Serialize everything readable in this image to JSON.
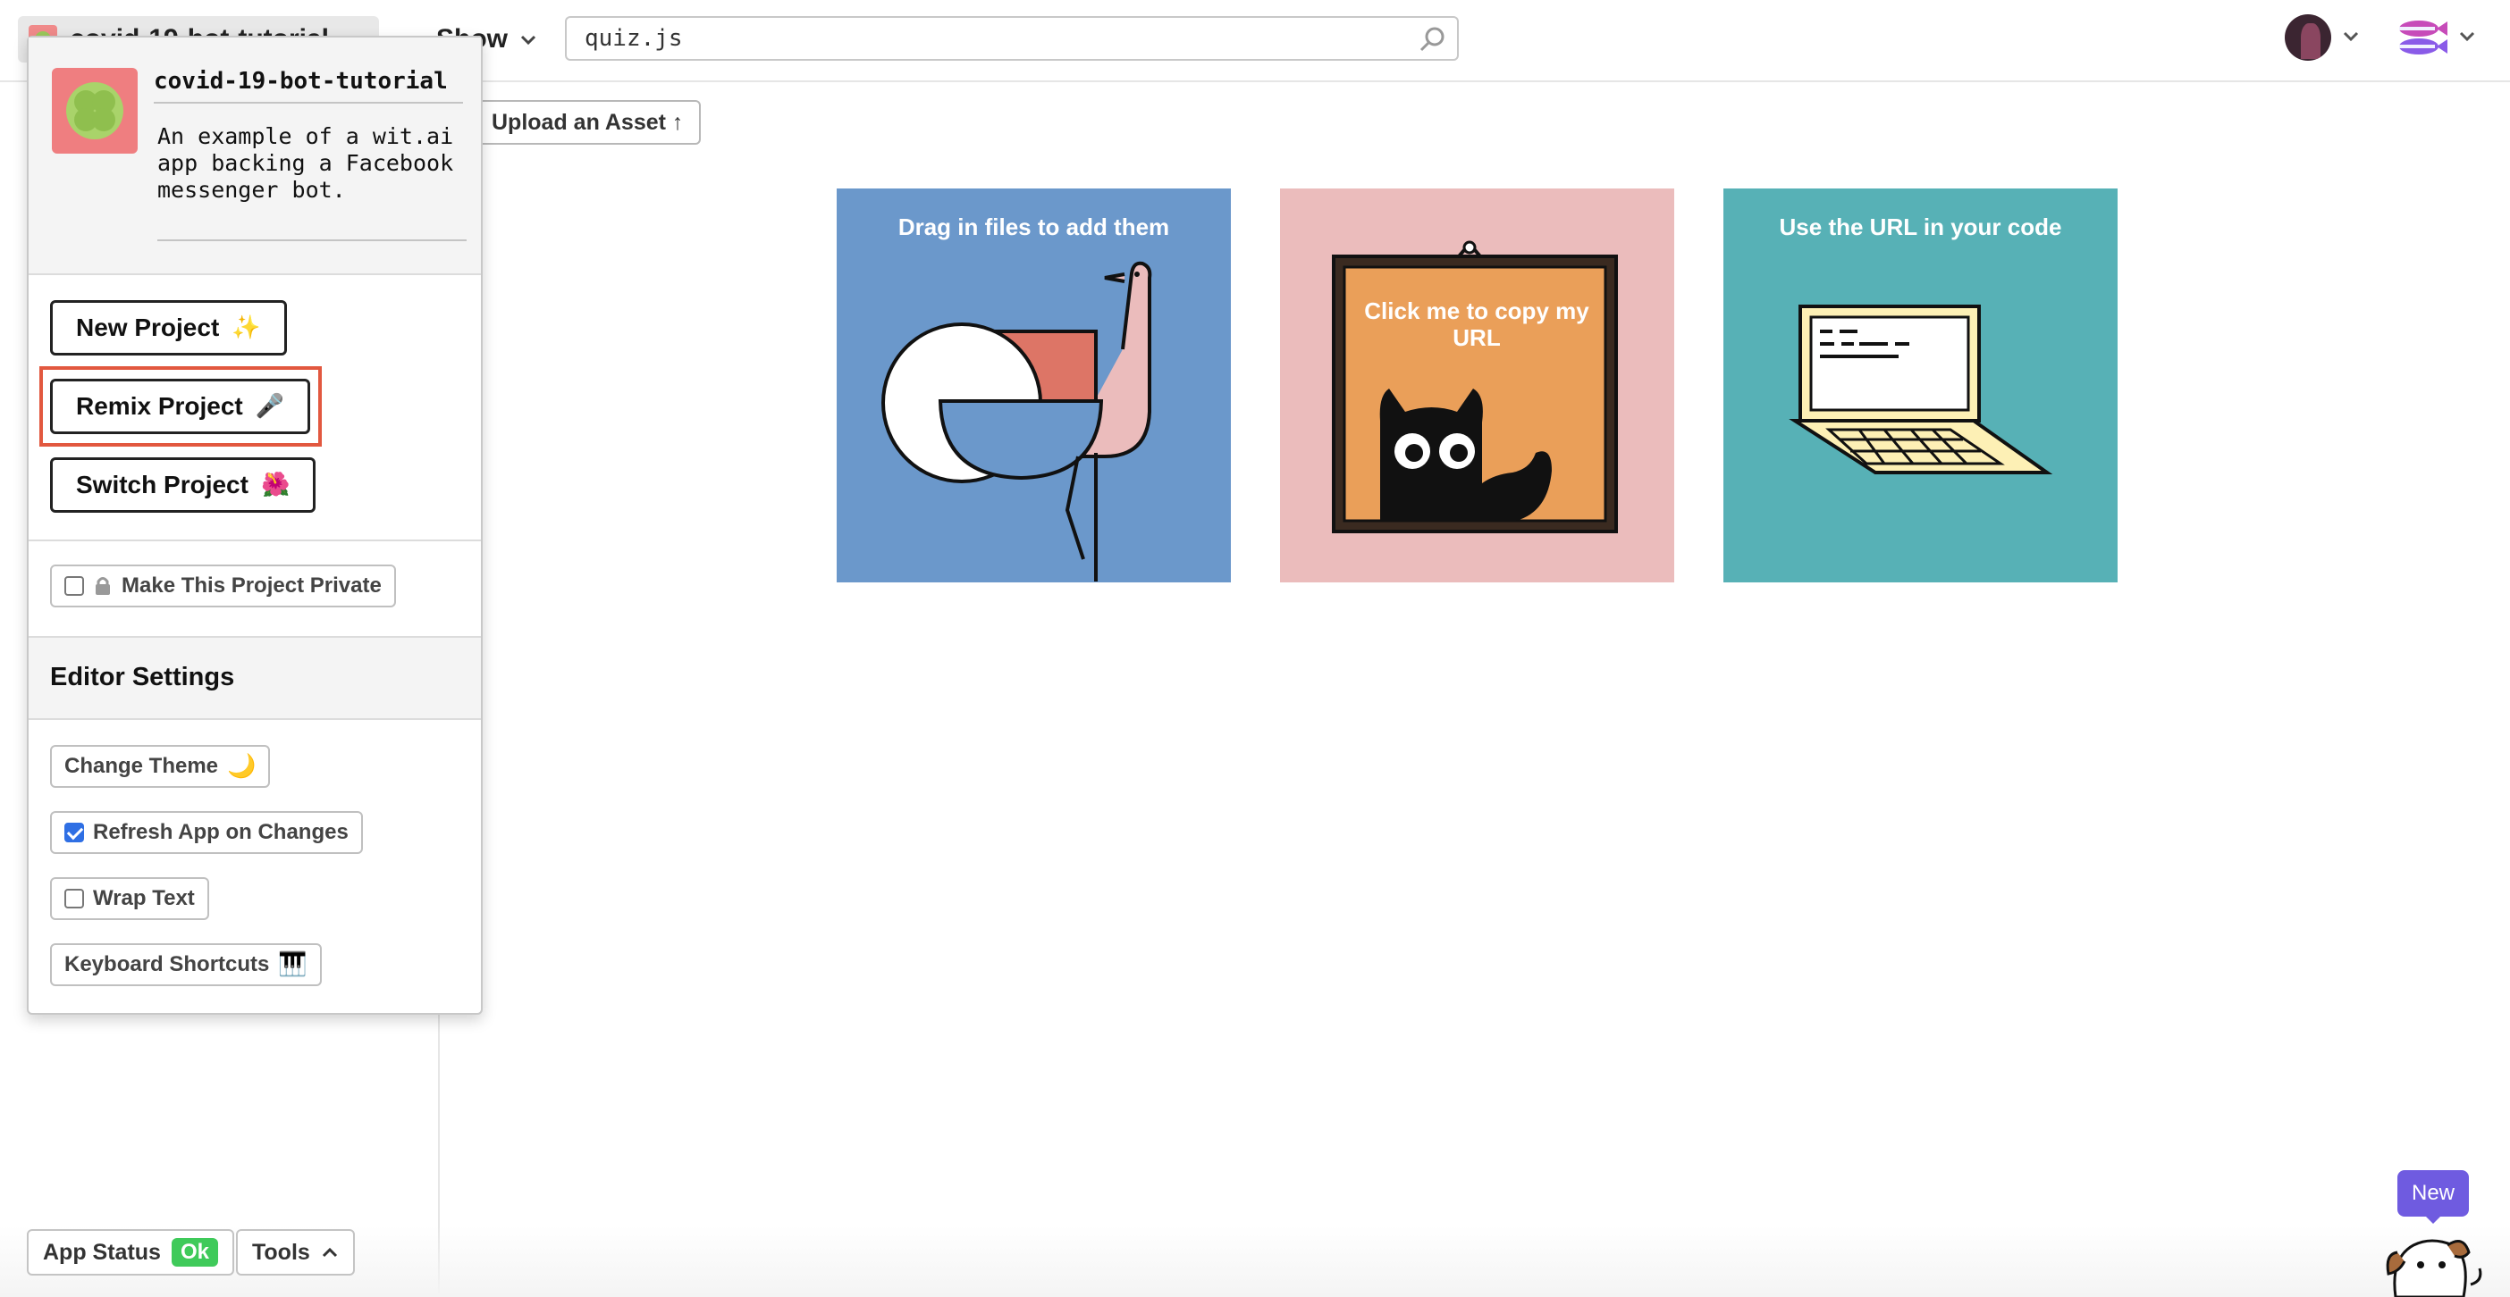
{
  "header": {
    "project_pill": "covid-19-bot-tutorial",
    "show_label": "Show",
    "search_value": "quiz.js"
  },
  "toolbar": {
    "upload_label": "Upload an Asset ↑"
  },
  "cards": [
    {
      "title": "Drag in files to add them",
      "color": "#6b98cb"
    },
    {
      "title": "Click me to copy my URL",
      "color": "#ebbcbc"
    },
    {
      "title": "Use the URL in your code",
      "color": "#57b1b6"
    }
  ],
  "popover": {
    "project_name": "covid-19-bot-tutorial",
    "description": "An example of a wit.ai app backing a Facebook messenger bot.",
    "new_project": "New Project",
    "new_project_icon": "✨",
    "remix_project": "Remix Project",
    "remix_project_icon": "🎤",
    "switch_project": "Switch Project",
    "switch_project_icon": "🌺",
    "make_private": "Make This Project Private",
    "editor_settings": "Editor Settings",
    "change_theme": "Change Theme",
    "change_theme_icon": "🌙",
    "refresh_app": "Refresh App on Changes",
    "refresh_app_checked": true,
    "wrap_text": "Wrap Text",
    "wrap_text_checked": false,
    "keyboard_shortcuts": "Keyboard Shortcuts",
    "keyboard_shortcuts_icon": "🎹"
  },
  "bottom": {
    "app_status": "App Status",
    "status_badge": "Ok",
    "tools": "Tools",
    "new_badge": "New"
  },
  "colors": {
    "highlight": "#e2583f",
    "ok": "#3fca5a",
    "new_badge": "#6f5be0"
  }
}
